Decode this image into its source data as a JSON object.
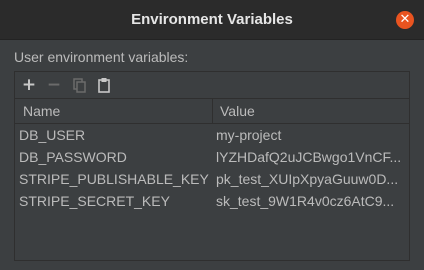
{
  "window": {
    "title": "Environment Variables",
    "close_icon": "close-icon",
    "close_glyph": "✕"
  },
  "section_label": "User environment variables:",
  "toolbar": {
    "add_icon": "plus-icon",
    "add_glyph": "+",
    "remove_icon": "minus-icon",
    "remove_glyph": "−",
    "copy_icon": "copy-icon",
    "paste_icon": "paste-icon"
  },
  "table": {
    "columns": [
      "Name",
      "Value"
    ],
    "rows": [
      {
        "name": "DB_USER",
        "value": "my-project"
      },
      {
        "name": "DB_PASSWORD",
        "value": "lYZHDafQ2uJCBwgo1VnCF..."
      },
      {
        "name": "STRIPE_PUBLISHABLE_KEY",
        "value": "pk_test_XUIpXpyaGuuw0D..."
      },
      {
        "name": "STRIPE_SECRET_KEY",
        "value": "sk_test_9W1R4v0cz6AtC9..."
      }
    ]
  },
  "colors": {
    "background": "#3c3f41",
    "titlebar": "#2b2b2b",
    "close_button": "#e95420",
    "text": "#bbbbbb"
  }
}
